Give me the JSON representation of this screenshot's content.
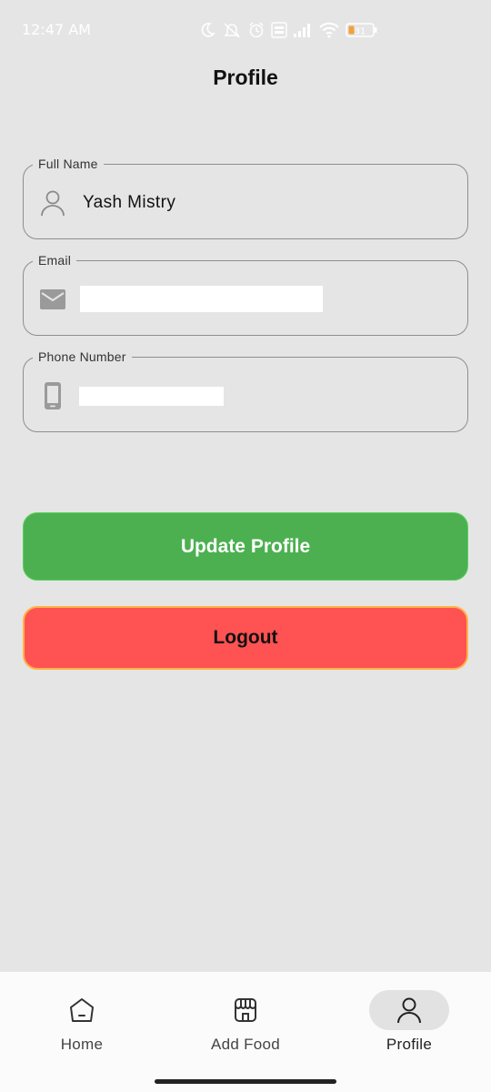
{
  "status_bar": {
    "time": "12:47 AM",
    "icons": [
      "moon-icon",
      "mute-icon",
      "alarm-icon",
      "volte-icon",
      "signal-icon",
      "wifi-icon",
      "battery-icon"
    ],
    "battery_level": "31"
  },
  "header": {
    "title": "Profile"
  },
  "form": {
    "full_name": {
      "label": "Full Name",
      "value": "Yash Mistry",
      "icon": "person-icon"
    },
    "email": {
      "label": "Email",
      "value": "",
      "icon": "mail-icon"
    },
    "phone": {
      "label": "Phone Number",
      "value": "",
      "icon": "phone-icon"
    }
  },
  "buttons": {
    "update_label": "Update Profile",
    "logout_label": "Logout"
  },
  "colors": {
    "background": "#e5e5e5",
    "update_button": "#4cb050",
    "logout_button": "#ff5252",
    "logout_border": "#ffb347"
  },
  "bottom_nav": {
    "items": [
      {
        "label": "Home",
        "icon": "home-icon",
        "active": false
      },
      {
        "label": "Add Food",
        "icon": "store-icon",
        "active": false
      },
      {
        "label": "Profile",
        "icon": "person-icon",
        "active": true
      }
    ]
  }
}
